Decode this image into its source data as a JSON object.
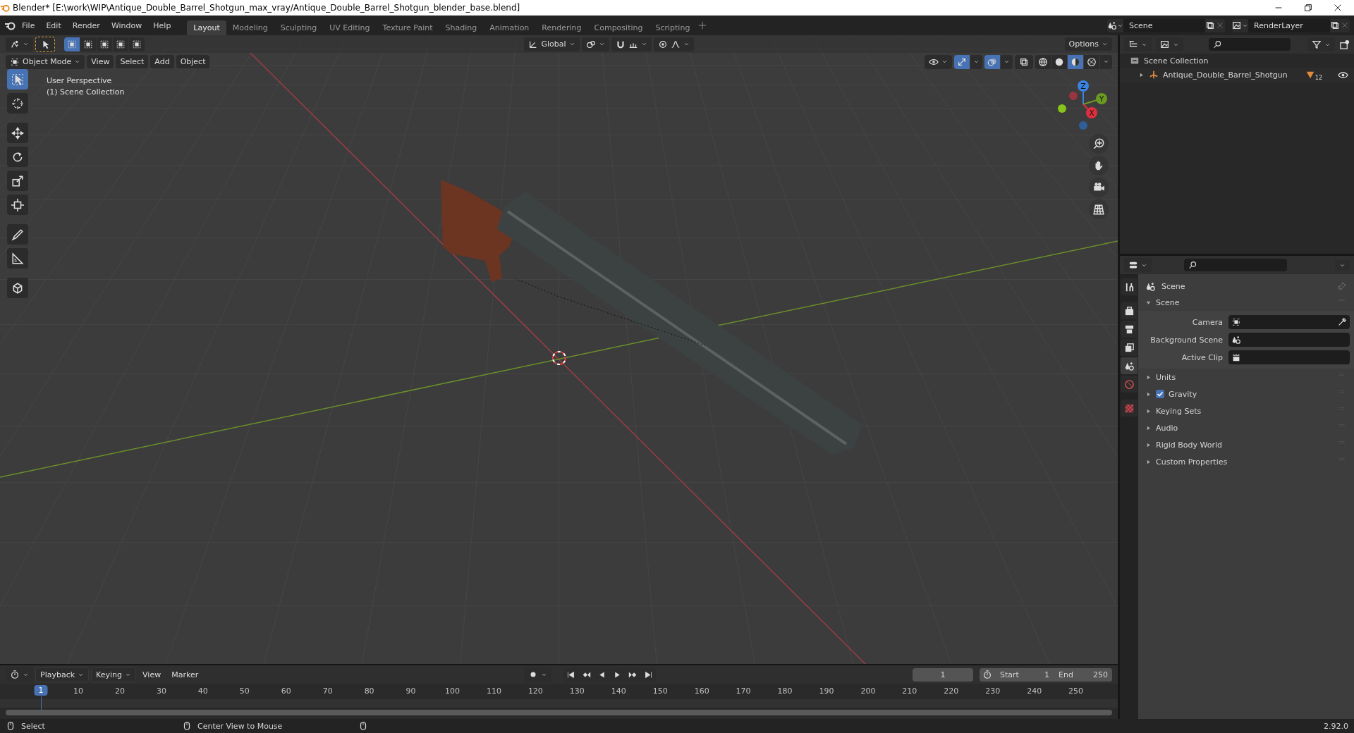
{
  "window": {
    "title": "Blender* [E:\\work\\WIP\\Antique_Double_Barrel_Shotgun_max_vray/Antique_Double_Barrel_Shotgun_blender_base.blend]"
  },
  "menu": [
    "File",
    "Edit",
    "Render",
    "Window",
    "Help"
  ],
  "workspaces": [
    {
      "label": "Layout",
      "selected": true
    },
    {
      "label": "Modeling",
      "selected": false
    },
    {
      "label": "Sculpting",
      "selected": false
    },
    {
      "label": "UV Editing",
      "selected": false
    },
    {
      "label": "Texture Paint",
      "selected": false
    },
    {
      "label": "Shading",
      "selected": false
    },
    {
      "label": "Animation",
      "selected": false
    },
    {
      "label": "Rendering",
      "selected": false
    },
    {
      "label": "Compositing",
      "selected": false
    },
    {
      "label": "Scripting",
      "selected": false
    }
  ],
  "scene": {
    "value": "Scene"
  },
  "view_layer": {
    "value": "RenderLayer"
  },
  "viewport": {
    "select_modes": [
      {
        "selected": true
      },
      {
        "selected": false
      },
      {
        "selected": false
      },
      {
        "selected": false
      },
      {
        "selected": false
      }
    ],
    "orientation": "Global",
    "options": "Options",
    "mode": "Object Mode",
    "menus": [
      "View",
      "Select",
      "Add",
      "Object"
    ],
    "gizmos": {
      "on": true
    },
    "overlays": {
      "on": true
    },
    "xray": {
      "on": false
    },
    "shading": [
      {
        "kind": "wireframe",
        "selected": false
      },
      {
        "kind": "solid",
        "selected": false
      },
      {
        "kind": "material",
        "selected": true
      },
      {
        "kind": "rendered",
        "selected": false
      }
    ],
    "info": [
      "User Perspective",
      "(1) Scene Collection"
    ],
    "tools": [
      {
        "kind": "select",
        "selected": true
      },
      {
        "kind": "cursor",
        "selected": false
      },
      {
        "kind": "move",
        "selected": false
      },
      {
        "kind": "rotate",
        "selected": false
      },
      {
        "kind": "scale",
        "selected": false
      },
      {
        "kind": "transform",
        "selected": false
      },
      {
        "kind": "annotate",
        "selected": false
      },
      {
        "kind": "measure",
        "selected": false
      },
      {
        "kind": "add-cube",
        "selected": false
      }
    ],
    "axes": [
      "Z",
      "Y",
      "X"
    ]
  },
  "outliner": {
    "items": [
      {
        "label": "Scene Collection",
        "children": [
          {
            "label": "Antique_Double_Barrel_Shotgun",
            "expanded": false,
            "badge": "12"
          }
        ]
      }
    ]
  },
  "properties": {
    "tabs": [
      {
        "kind": "tool",
        "selected": false
      },
      {
        "kind": "render",
        "selected": false
      },
      {
        "kind": "output",
        "selected": false
      },
      {
        "kind": "view-layer",
        "selected": false
      },
      {
        "kind": "scene",
        "selected": true
      },
      {
        "kind": "world",
        "selected": false
      },
      {
        "kind": "texture",
        "selected": false
      }
    ],
    "context": "Scene",
    "panel": {
      "title": "Scene",
      "expanded": true,
      "fields": [
        {
          "label": "Camera",
          "kind": "camera"
        },
        {
          "label": "Background Scene",
          "kind": "scene"
        },
        {
          "label": "Active Clip",
          "kind": "clip"
        }
      ]
    },
    "subpanels": [
      {
        "label": "Units",
        "expanded": false
      },
      {
        "label": "Gravity",
        "expanded": false,
        "checked": true
      },
      {
        "label": "Keying Sets",
        "expanded": false
      },
      {
        "label": "Audio",
        "expanded": false
      },
      {
        "label": "Rigid Body World",
        "expanded": false
      },
      {
        "label": "Custom Properties",
        "expanded": false
      }
    ]
  },
  "timeline": {
    "menus": [
      {
        "label": "Playback",
        "kind": "dropdown"
      },
      {
        "label": "Keying",
        "kind": "dropdown"
      },
      {
        "label": "View",
        "kind": "menu"
      },
      {
        "label": "Marker",
        "kind": "menu"
      }
    ],
    "current_frame": "1",
    "start_label": "Start",
    "start": "1",
    "end_label": "End",
    "end": "250",
    "playhead": "1",
    "ruler": [
      "10",
      "20",
      "30",
      "40",
      "50",
      "60",
      "70",
      "80",
      "90",
      "100",
      "110",
      "120",
      "130",
      "140",
      "150",
      "160",
      "170",
      "180",
      "190",
      "200",
      "210",
      "220",
      "230",
      "240",
      "250"
    ]
  },
  "status_bar": {
    "hints": [
      "Select",
      "Center View to Mouse"
    ],
    "version": "2.92.0"
  }
}
